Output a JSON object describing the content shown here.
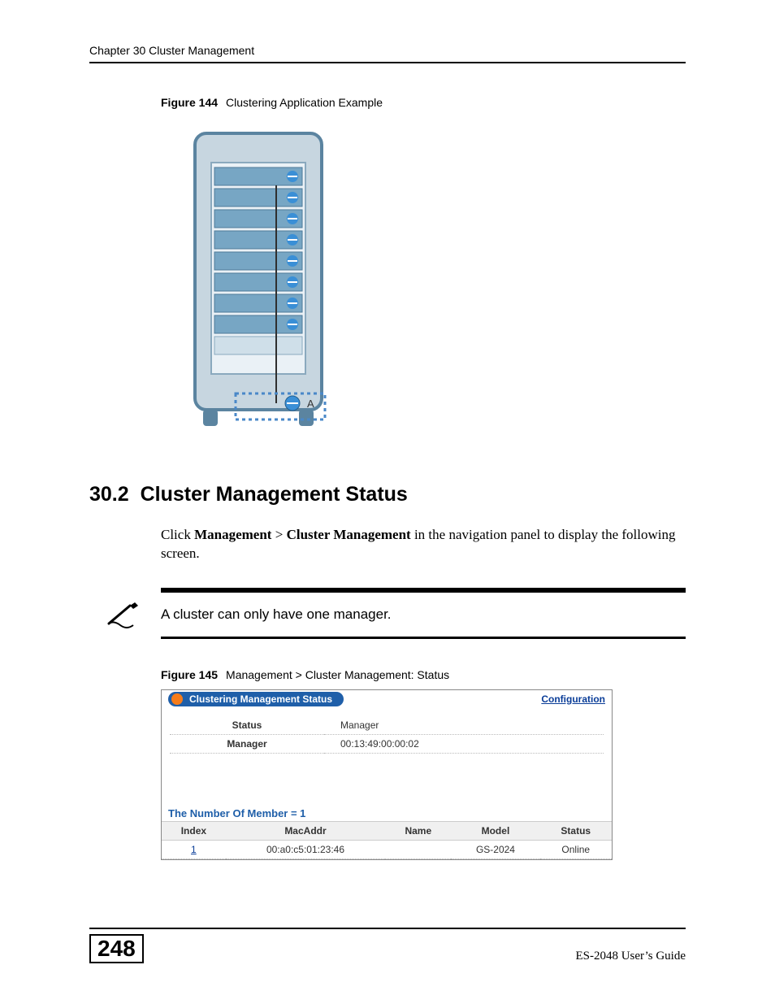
{
  "header": {
    "chapter": "Chapter 30 Cluster Management"
  },
  "figure144": {
    "label": "Figure 144",
    "caption": "Clustering Application Example",
    "badge": "A"
  },
  "section": {
    "number": "30.2",
    "title": "Cluster Management Status"
  },
  "paragraph": {
    "pre": "Click ",
    "b1": "Management",
    "mid": " > ",
    "b2": "Cluster Management",
    "post": " in the navigation panel to display the following screen."
  },
  "note": {
    "text": "A cluster can only have one manager."
  },
  "figure145": {
    "label": "Figure 145",
    "caption": "Management > Cluster Management: Status",
    "panel_title": "Clustering Management Status",
    "config_link": "Configuration",
    "status_rows": [
      {
        "label": "Status",
        "value": "Manager"
      },
      {
        "label": "Manager",
        "value": "00:13:49:00:00:02"
      }
    ],
    "member_count": "The Number Of Member = 1",
    "columns": [
      "Index",
      "MacAddr",
      "Name",
      "Model",
      "Status"
    ],
    "rows": [
      {
        "Index": "1",
        "MacAddr": "00:a0:c5:01:23:46",
        "Name": "",
        "Model": "GS-2024",
        "Status": "Online"
      }
    ]
  },
  "footer": {
    "page": "248",
    "guide": "ES-2048 User’s Guide"
  }
}
